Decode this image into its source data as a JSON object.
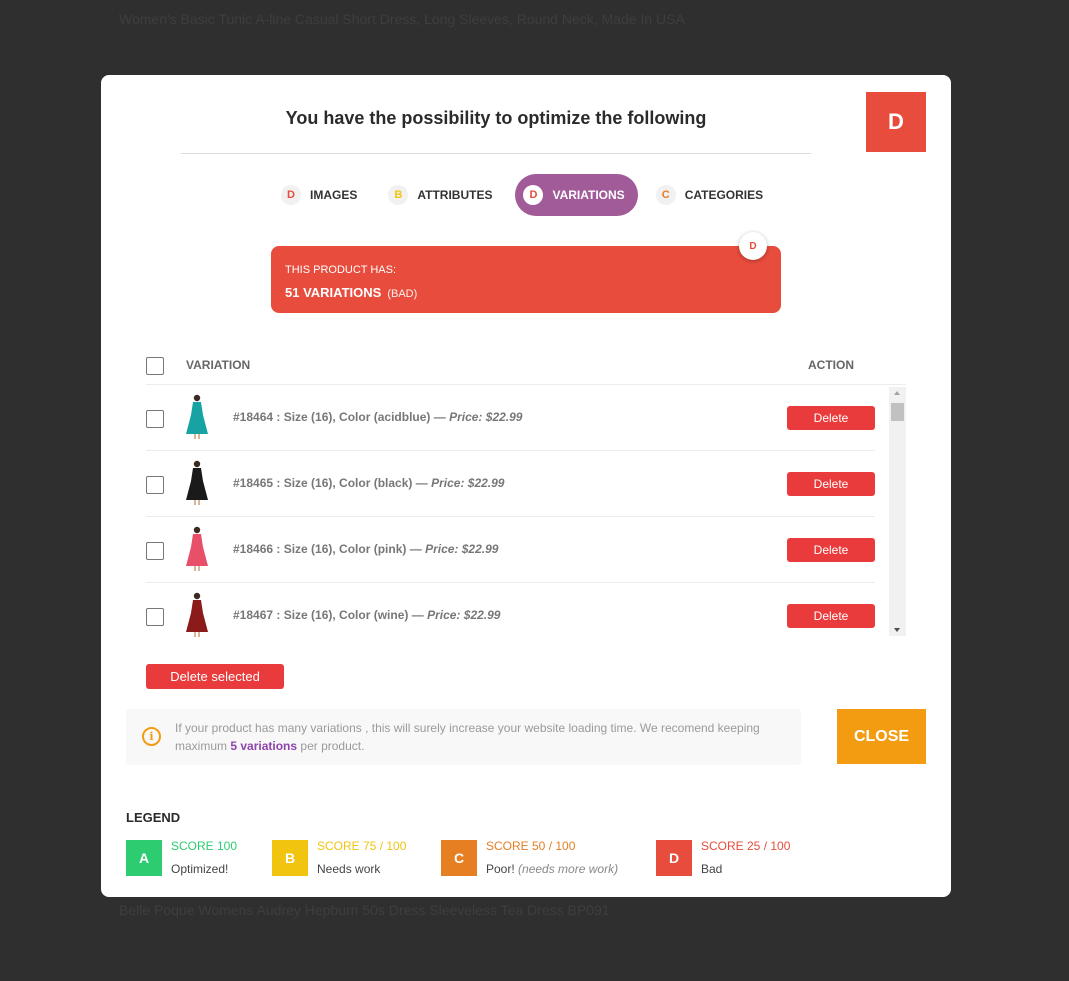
{
  "background": {
    "top_product": "Women's Basic Tunic A-line Casual Short Dress, Long Sleeves, Round Neck, Made In USA",
    "bottom_product": "Belle Poque Womens Audrey Hepburn 50s Dress Sleeveless Tea Dress BP091"
  },
  "modal": {
    "title": "You have the possibility to optimize the following",
    "grade": "D",
    "grade_color": "#e74c3c"
  },
  "tabs": [
    {
      "letter": "D",
      "label": "IMAGES",
      "color": "#e74c3c"
    },
    {
      "letter": "B",
      "label": "ATTRIBUTES",
      "color": "#f1c40f"
    },
    {
      "letter": "D",
      "label": "VARIATIONS",
      "color": "#e74c3c",
      "active": true
    },
    {
      "letter": "C",
      "label": "CATEGORIES",
      "color": "#e67e22"
    }
  ],
  "summary": {
    "label": "THIS PRODUCT HAS:",
    "value": "51 VARIATIONS",
    "quality": "(BAD)",
    "badge": "D"
  },
  "table": {
    "col_variation": "VARIATION",
    "col_action": "ACTION",
    "rows": [
      {
        "desc": "#18464 : Size (16), Color (acidblue) —",
        "price": "Price: $22.99",
        "action": "Delete",
        "dress_color": "#17a3a3"
      },
      {
        "desc": "#18465 : Size (16), Color (black) —",
        "price": "Price: $22.99",
        "action": "Delete",
        "dress_color": "#1a1a1a"
      },
      {
        "desc": "#18466 : Size (16), Color (pink) —",
        "price": "Price: $22.99",
        "action": "Delete",
        "dress_color": "#e8506a"
      },
      {
        "desc": "#18467 : Size (16), Color (wine) —",
        "price": "Price: $22.99",
        "action": "Delete",
        "dress_color": "#8b1a1a"
      }
    ]
  },
  "delete_selected": "Delete selected",
  "info": {
    "icon": "i",
    "text_before": "If your product has many variations , this will surely increase your website loading time. We recomend keeping maximum",
    "highlight": "5 variations",
    "text_after": "per product."
  },
  "close_label": "CLOSE",
  "legend": {
    "title": "LEGEND",
    "items": [
      {
        "letter": "A",
        "score": "SCORE 100",
        "desc": "Optimized!",
        "note": "",
        "color": "#2ecc71"
      },
      {
        "letter": "B",
        "score": "SCORE 75 / 100",
        "desc": "Needs work",
        "note": "",
        "color": "#f1c40f"
      },
      {
        "letter": "C",
        "score": "SCORE 50 / 100",
        "desc": "Poor!",
        "note": "(needs more work)",
        "color": "#e67e22"
      },
      {
        "letter": "D",
        "score": "SCORE 25 / 100",
        "desc": "Bad",
        "note": "",
        "color": "#e74c3c"
      }
    ]
  }
}
